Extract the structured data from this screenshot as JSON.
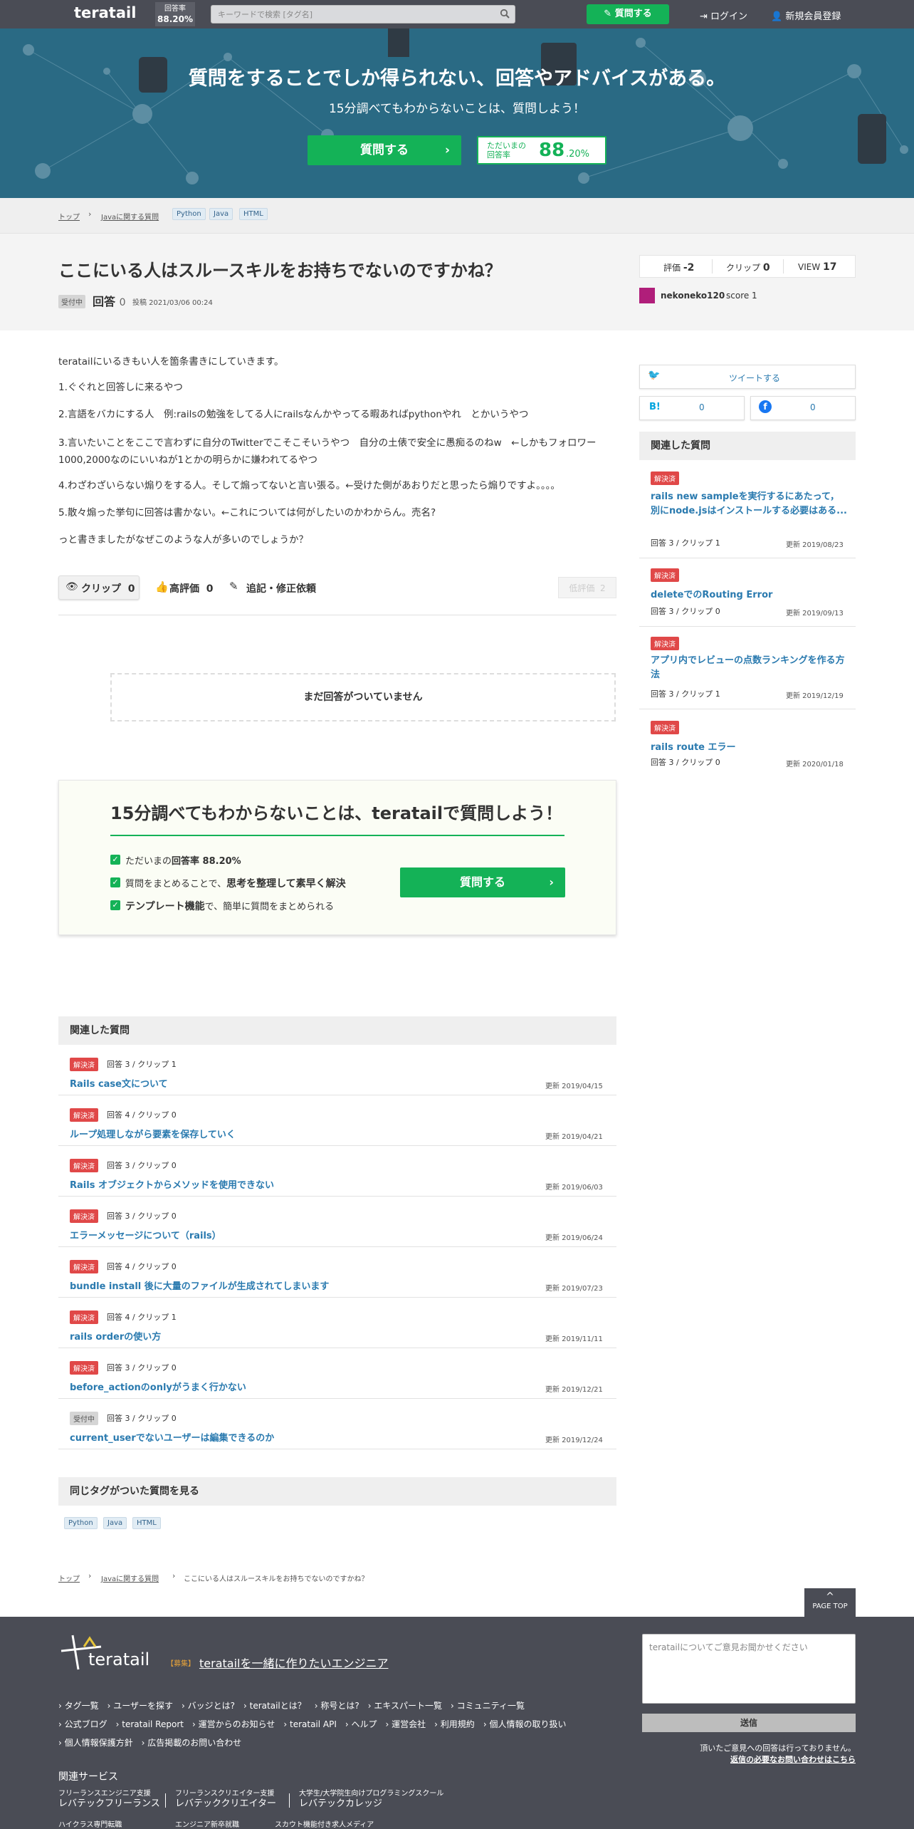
{
  "header": {
    "logo": "teratail",
    "rate_label": "回答率",
    "rate_value": "88.20%",
    "search_placeholder": "キーワードで検索 [タグ名]",
    "ask_label": "質問する",
    "login_label": "ログイン",
    "signup_label": "新規会員登録"
  },
  "hero": {
    "title": "質問をすることでしか得られない、回答やアドバイスがある。",
    "subtitle": "15分調べてもわからないことは、質問しよう！",
    "ask_label": "質問する",
    "rate_label_1": "ただいまの",
    "rate_label_2": "回答率",
    "rate_int": "88",
    "rate_dec": ".20%"
  },
  "breadcrumb": {
    "top": "トップ",
    "category": "Javaに関する質問",
    "tags": [
      "Python",
      "Java",
      "HTML"
    ],
    "current": "ここにいる人はスルースキルをお持ちでないのですかね？"
  },
  "question": {
    "title": "ここにいる人はスルースキルをお持ちでないのですかね？",
    "status": "受付中",
    "answers_label": "回答",
    "answers_count": "0",
    "posted": "投稿 2021/03/06 00:24",
    "stats": {
      "rating_label": "評価",
      "rating": "-2",
      "clip_label": "クリップ",
      "clip": "0",
      "view_label": "VIEW",
      "view": "17"
    },
    "author": "nekoneko120",
    "author_score": "score 1",
    "body": [
      "teratailにいるきもい人を箇条書きにしていきます。",
      "1.ぐぐれと回答しに来るやつ",
      "2.言語をバカにする人　例:railsの勉強をしてる人にrailsなんかやってる暇あればpythonやれ　とかいうやつ",
      "3.言いたいことをここで言わずに自分のTwitterでこそこそいうやつ　自分の土俵で安全に愚痴るのねw　←しかもフォロワー1000,2000なのにいいねが1とかの明らかに嫌われてるやつ",
      "4.わざわざいらない煽りをする人。そして煽ってないと言い張る。←受けた側があおりだと思ったら煽りですよ。。。。",
      "5.散々煽った挙句に回答は書かない。←これについては何がしたいのかわからん。売名?",
      "っと書きましたがなぜこのような人が多いのでしょうか？"
    ],
    "actions": {
      "clip_label": "クリップ",
      "clip_count": "0",
      "good_label": "高評価",
      "good_count": "0",
      "edit_label": "追記・修正依頼",
      "low_label": "低評価",
      "low_count": "2"
    },
    "no_answer": "まだ回答がついていません"
  },
  "promo": {
    "title": "15分調べてもわからないことは、teratailで質問しよう！",
    "l1_a": "ただいまの",
    "l1_b": "回答率 88.20%",
    "l2_a": "質問をまとめることで、",
    "l2_b": "思考を整理して素早く解決",
    "l3_a": "テンプレート機能",
    "l3_b": "で、簡単に質問をまとめられる",
    "ask_label": "質問する"
  },
  "related_main": {
    "heading": "関連した質問",
    "items": [
      {
        "status": "解決済",
        "meta": "回答 3 / クリップ 1",
        "title": "Rails case文について",
        "date": "更新 2019/04/15"
      },
      {
        "status": "解決済",
        "meta": "回答 4 / クリップ 0",
        "title": "ループ処理しながら要素を保存していく",
        "date": "更新 2019/04/21"
      },
      {
        "status": "解決済",
        "meta": "回答 3 / クリップ 0",
        "title": "Rails オブジェクトからメソッドを使用できない",
        "date": "更新 2019/06/03"
      },
      {
        "status": "解決済",
        "meta": "回答 3 / クリップ 0",
        "title": "エラーメッセージについて（rails）",
        "date": "更新 2019/06/24"
      },
      {
        "status": "解決済",
        "meta": "回答 4 / クリップ 0",
        "title": "bundle install 後に大量のファイルが生成されてしまいます",
        "date": "更新 2019/07/23"
      },
      {
        "status": "解決済",
        "meta": "回答 4 / クリップ 1",
        "title": "rails orderの使い方",
        "date": "更新 2019/11/11"
      },
      {
        "status": "解決済",
        "meta": "回答 3 / クリップ 0",
        "title": "before_actionのonlyがうまく行かない",
        "date": "更新 2019/12/21"
      },
      {
        "status": "受付中",
        "meta": "回答 3 / クリップ 0",
        "title": "current_userでないユーザーは編集できるのか",
        "date": "更新 2019/12/24"
      }
    ]
  },
  "same_tags": {
    "heading": "同じタグがついた質問を見る",
    "tags": [
      "Python",
      "Java",
      "HTML"
    ]
  },
  "sidebar": {
    "tweet_label": "ツイートする",
    "hatena_icon": "B!",
    "hatena_count": "0",
    "fb_count": "0",
    "related_heading": "関連した質問",
    "related": [
      {
        "status": "解決済",
        "title": "rails new sampleを実行するにあたって，別にnode.jsはインストールする必要はある...",
        "meta": "回答 3 / クリップ 1",
        "date": "更新 2019/08/23"
      },
      {
        "status": "解決済",
        "title": "deleteでのRouting Error",
        "meta": "回答 3 / クリップ 0",
        "date": "更新 2019/09/13"
      },
      {
        "status": "解決済",
        "title": "アプリ内でレビューの点数ランキングを作る方法",
        "meta": "回答 3 / クリップ 1",
        "date": "更新 2019/12/19"
      },
      {
        "status": "解決済",
        "title": "rails route エラー",
        "meta": "回答 3 / クリップ 0",
        "date": "更新 2020/01/18"
      }
    ]
  },
  "footer": {
    "page_top": "PAGE TOP",
    "logo": "teratail",
    "recruit_tag": "【募集】",
    "recruit_text": "teratailを一緒に作りたいエンジニア",
    "links_row1": [
      "タグ一覧",
      "ユーザーを探す",
      "バッジとは?",
      "teratailとは？",
      "称号とは?",
      "エキスパート一覧",
      "コミュニティ一覧"
    ],
    "links_row2": [
      "公式ブログ",
      "teratail Report",
      "運営からのお知らせ",
      "teratail API",
      "ヘルプ",
      "運営会社",
      "利用規約",
      "個人情報の取り扱い"
    ],
    "links_row3": [
      "個人情報保護方針",
      "広告掲載のお問い合わせ"
    ],
    "feedback_placeholder": "teratailについてご意見お聞かせください",
    "send_label": "送信",
    "note1": "頂いたご意見への回答は行っておりません。",
    "note2": "返信の必要なお問い合わせはこちら",
    "services_heading": "関連サービス",
    "services": [
      {
        "sub": "フリーランスエンジニア支援",
        "name": "レバテックフリーランス"
      },
      {
        "sub": "フリーランスクリエイター支援",
        "name": "レバテッククリエイター"
      },
      {
        "sub": "大学生/大学院生向けプログラミングスクール",
        "name": "レバテックカレッジ"
      }
    ],
    "services_row2": [
      "ハイクラス専門転職",
      "エンジニア新卒就職",
      "スカウト機能付き求人メディア"
    ]
  }
}
